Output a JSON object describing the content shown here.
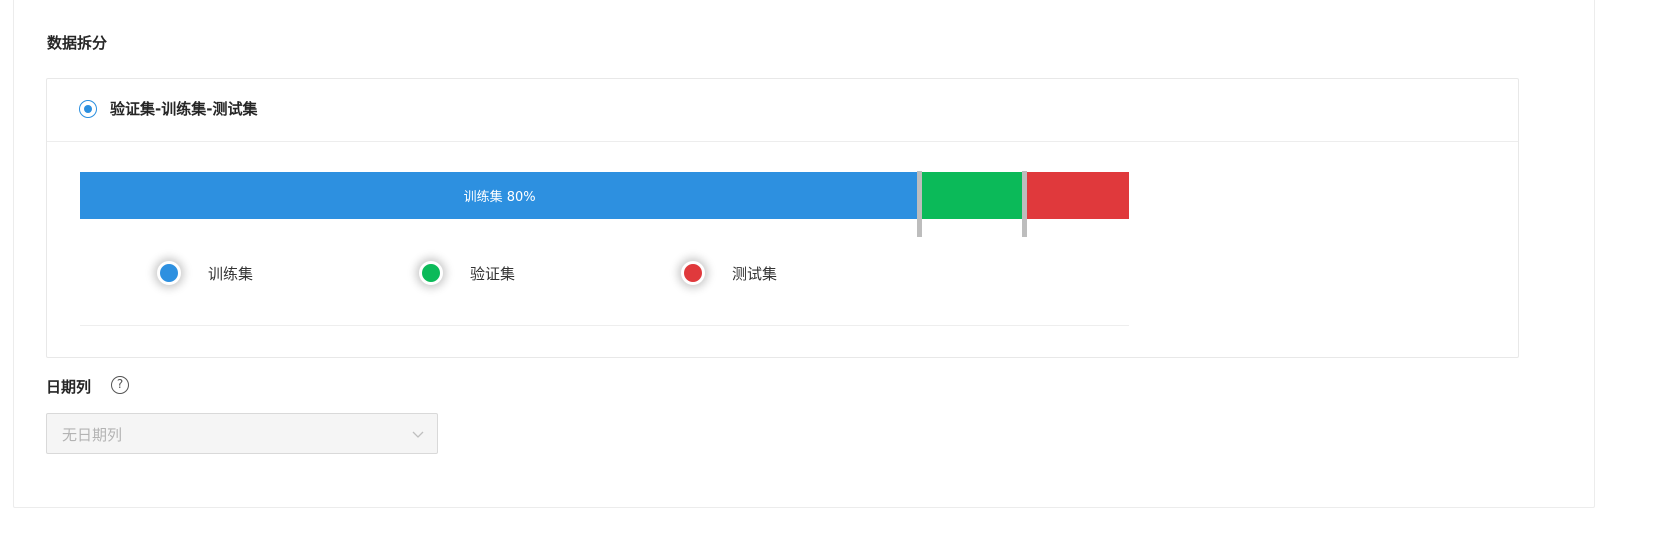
{
  "section": {
    "title": "数据拆分"
  },
  "split_option": {
    "label": "验证集-训练集-测试集",
    "selected": true
  },
  "split": {
    "train_label": "训练集 80%",
    "train_percent": 80,
    "validation_percent": 10,
    "test_percent": 10,
    "colors": {
      "train": "#2d90e0",
      "validation": "#0bba59",
      "test": "#e0393c"
    }
  },
  "legend": [
    {
      "label": "训练集",
      "color": "#2d90e0"
    },
    {
      "label": "验证集",
      "color": "#0bba59"
    },
    {
      "label": "测试集",
      "color": "#e0393c"
    }
  ],
  "date_column": {
    "label": "日期列",
    "help_icon": "question-circle-icon",
    "select_value": "无日期列",
    "chevron_icon": "chevron-down-icon",
    "disabled": true
  }
}
